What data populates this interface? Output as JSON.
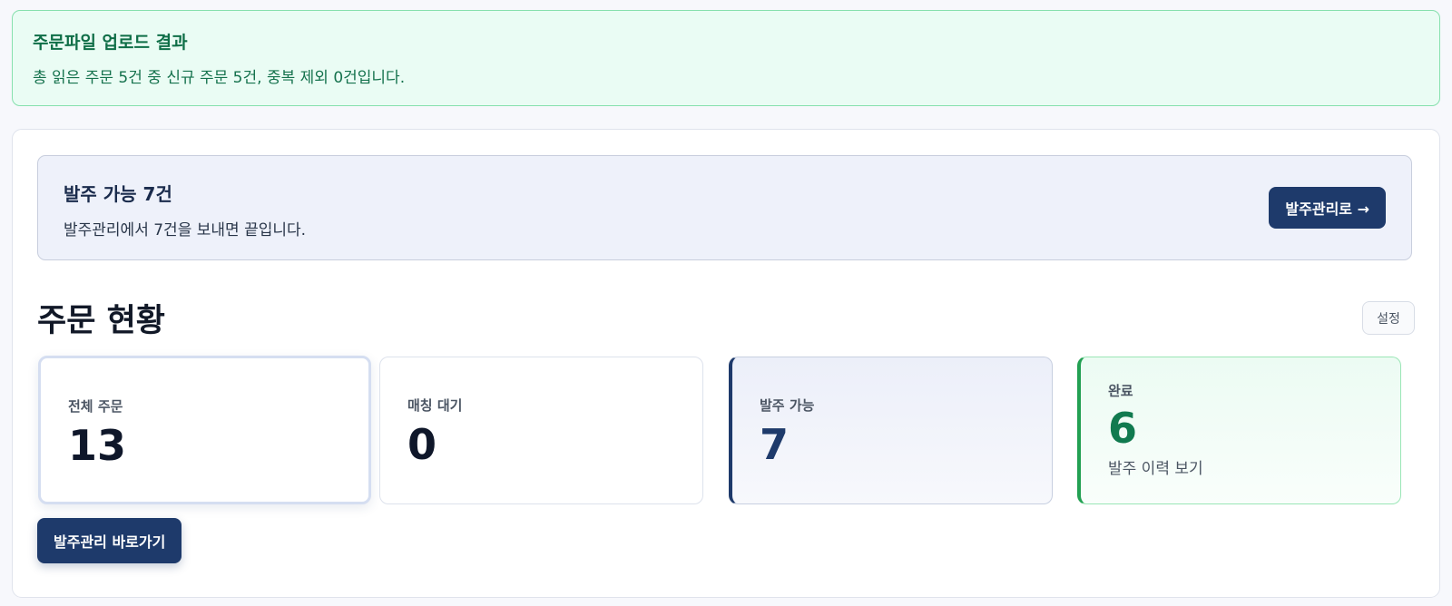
{
  "upload_result": {
    "title": "주문파일 업로드 결과",
    "description": "총 읽은 주문 5건 중 신규 주문 5건, 중복 제외 0건입니다."
  },
  "order_ready_banner": {
    "title": "발주 가능 7건",
    "description": "발주관리에서 7건을 보내면 끝입니다.",
    "button_label": "발주관리로 →"
  },
  "order_status": {
    "title": "주문 현황",
    "settings_label": "설정",
    "cards": [
      {
        "label": "전체 주문",
        "value": "13"
      },
      {
        "label": "매칭 대기",
        "value": "0"
      },
      {
        "label": "발주 가능",
        "value": "7"
      },
      {
        "label": "완료",
        "value": "6",
        "link": "발주 이력 보기"
      }
    ],
    "shortcut_button_label": "발주관리 바로가기"
  },
  "colors": {
    "success_green": "#117a4f",
    "primary_navy": "#1e3a6b"
  }
}
